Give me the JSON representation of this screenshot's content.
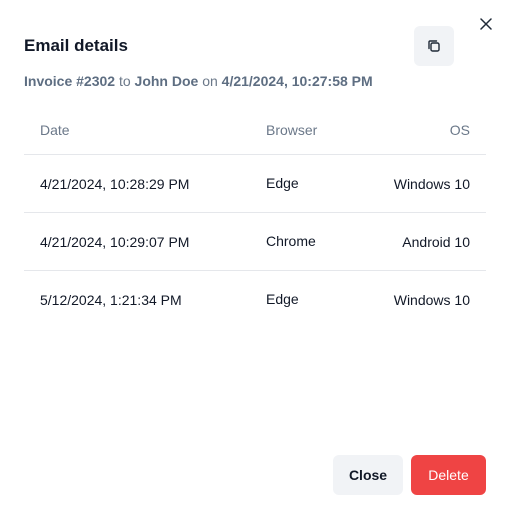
{
  "dialog": {
    "title": "Email details",
    "subtitle": {
      "invoice": "Invoice #2302",
      "to_word": "to",
      "recipient": "John Doe",
      "on_word": "on",
      "datetime": "4/21/2024, 10:27:58 PM"
    }
  },
  "table": {
    "headers": {
      "date": "Date",
      "browser": "Browser",
      "os": "OS"
    },
    "rows": [
      {
        "date": "4/21/2024, 10:28:29 PM",
        "browser": "Edge",
        "os": "Windows 10"
      },
      {
        "date": "4/21/2024, 10:29:07 PM",
        "browser": "Chrome",
        "os": "Android 10"
      },
      {
        "date": "5/12/2024, 1:21:34 PM",
        "browser": "Edge",
        "os": "Windows 10"
      }
    ]
  },
  "footer": {
    "close_label": "Close",
    "delete_label": "Delete"
  },
  "icons": {
    "close": "close-icon",
    "copy": "copy-icon"
  },
  "colors": {
    "delete_bg": "#ef4444",
    "secondary_bg": "#f1f3f6",
    "muted_text": "#6b7889",
    "divider": "#e5e7eb"
  }
}
